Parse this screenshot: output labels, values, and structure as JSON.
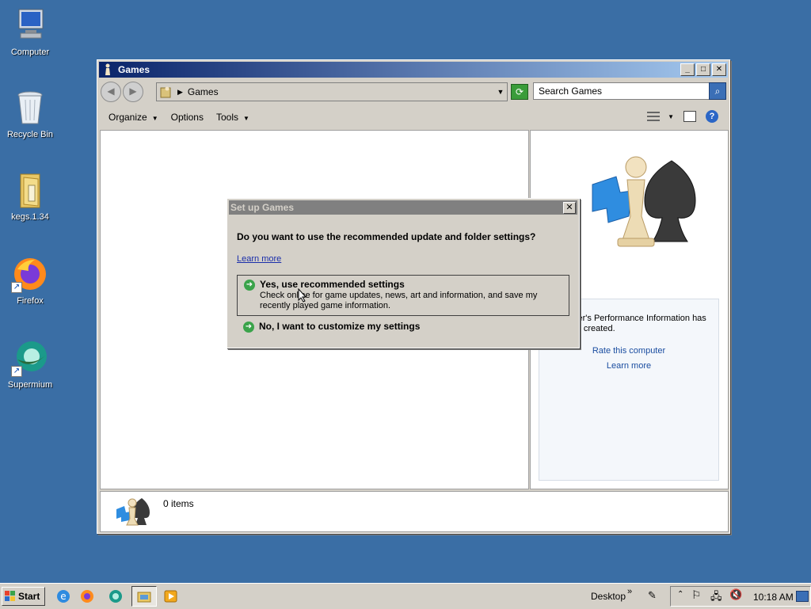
{
  "desktop": {
    "icons": [
      {
        "label": "Computer"
      },
      {
        "label": "Recycle Bin"
      },
      {
        "label": "kegs.1.34"
      },
      {
        "label": "Firefox"
      },
      {
        "label": "Supermium"
      }
    ]
  },
  "window": {
    "title": "Games",
    "address": "Games",
    "search_placeholder": "Search Games",
    "toolbar": {
      "organize": "Organize",
      "options": "Options",
      "tools": "Tools"
    },
    "preview": {
      "perf_text": "Computer's Performance Information has not been created.",
      "rate_link": "Rate this computer",
      "learn_link": "Learn more"
    },
    "status": {
      "items": "0 items"
    }
  },
  "dialog": {
    "title": "Set up Games",
    "question": "Do you want to use the recommended update and folder settings?",
    "learn_more": "Learn more",
    "option_recommended": {
      "title": "Yes, use recommended settings",
      "description": "Check online for game updates, news, art and information, and save my recently played game information."
    },
    "option_custom": {
      "title": "No, I want to customize my settings"
    }
  },
  "taskbar": {
    "start": "Start",
    "desktop_label": "Desktop",
    "clock": "10:18 AM"
  },
  "colors": {
    "desktop": "#3a6ea5",
    "titlebar_active": "#0a246a",
    "titlebar_inactive": "#808080",
    "link": "#1a2eaa",
    "green_arrow": "#3aa34a"
  }
}
